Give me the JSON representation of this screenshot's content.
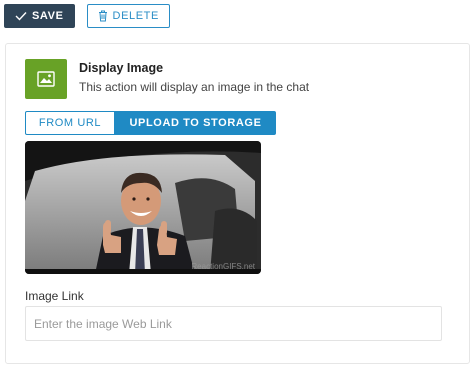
{
  "toolbar": {
    "save_label": "SAVE",
    "delete_label": "DELETE"
  },
  "action": {
    "title": "Display Image",
    "description": "This action will display an image in the chat",
    "icon": "image-icon",
    "icon_color": "#68a226"
  },
  "tabs": [
    {
      "label": "FROM URL",
      "active": false
    },
    {
      "label": "UPLOAD TO STORAGE",
      "active": true
    }
  ],
  "preview": {
    "content": "man giving two thumbs up from car window",
    "watermark": "ReactionGIFS.net"
  },
  "image_link": {
    "label": "Image Link",
    "value": "",
    "placeholder": "Enter the image Web Link"
  },
  "colors": {
    "save_bg": "#2f4457",
    "accent_blue": "#1f8ac4",
    "action_green": "#68a226"
  }
}
